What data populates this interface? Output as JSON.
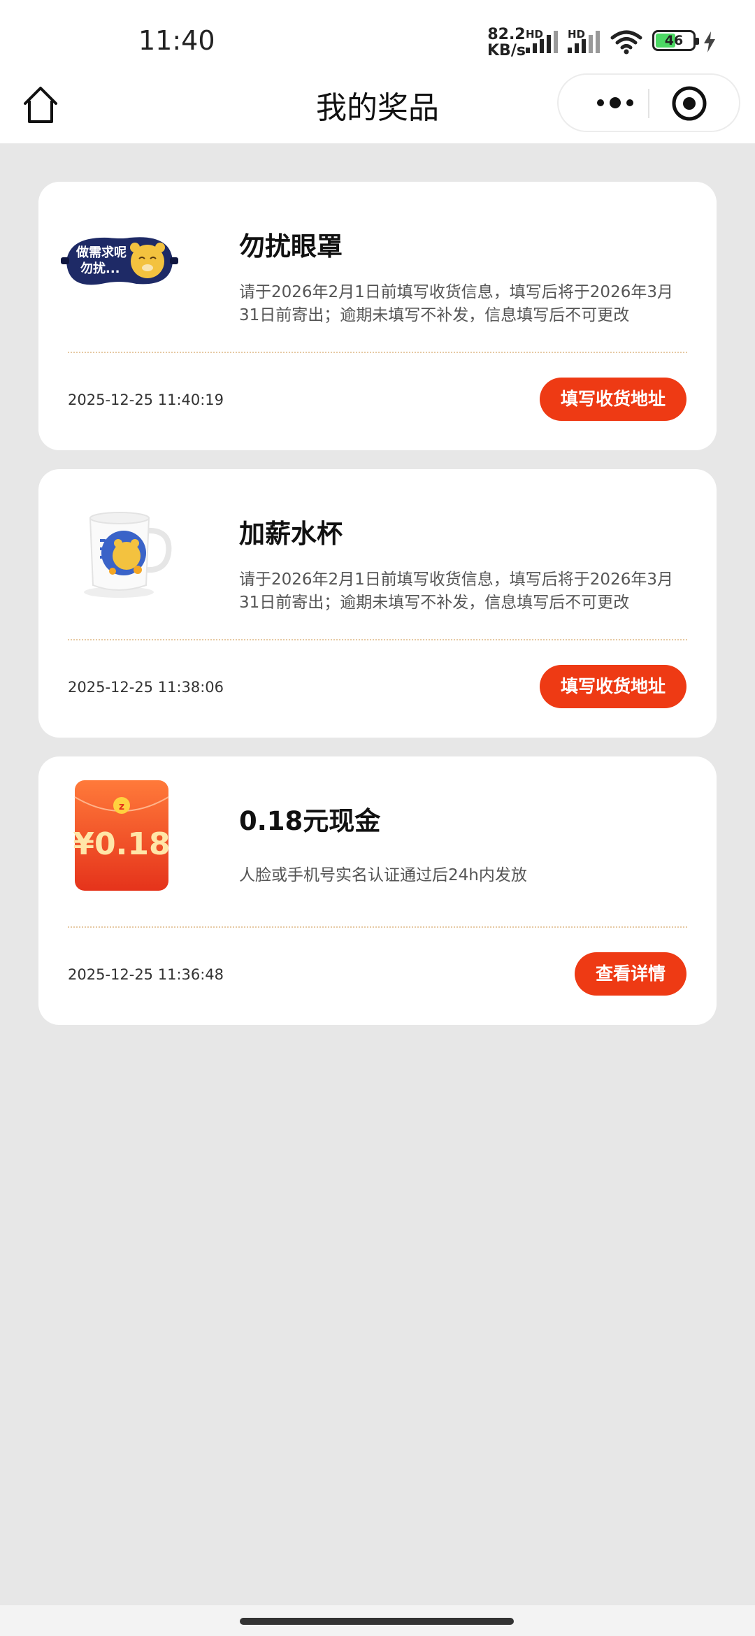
{
  "status_bar": {
    "time": "11:40",
    "net_speed_value": "82.2",
    "net_speed_unit": "KB/s",
    "hd_label_1": "HD",
    "hd_label_2": "HD",
    "battery_level": "46"
  },
  "navbar": {
    "title": "我的奖品"
  },
  "prizes": [
    {
      "name": "勿扰眼罩",
      "desc": "请于2026年2月1日前填写收货信息，填写后将于2026年3月31日前寄出；逾期未填写不补发，信息填写后不可更改",
      "timestamp": "2025-12-25 11:40:19",
      "button": "填写收货地址",
      "image_text_1": "做需求呢",
      "image_text_2": "勿扰..."
    },
    {
      "name": "加薪水杯",
      "desc": "请于2026年2月1日前填写收货信息，填写后将于2026年3月31日前寄出；逾期未填写不补发，信息填写后不可更改",
      "timestamp": "2025-12-25 11:38:06",
      "button": "填写收货地址"
    },
    {
      "name": "0.18元现金",
      "desc": "人脸或手机号实名认证通过后24h内发放",
      "timestamp": "2025-12-25 11:36:48",
      "button": "查看详情",
      "image_amount": "¥0.18"
    }
  ],
  "colors": {
    "accent": "#ee3a14",
    "page_bg": "#e7e7e7",
    "separator": "#e6c9a3"
  }
}
